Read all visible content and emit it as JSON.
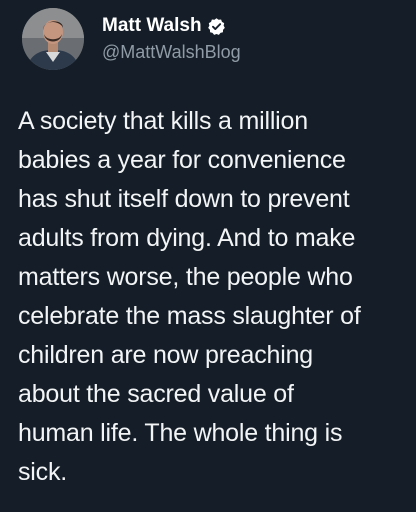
{
  "tweet": {
    "author": {
      "display_name": "Matt Walsh",
      "handle": "@MattWalshBlog",
      "verified": true,
      "avatar_icon": "profile-photo",
      "verified_icon": "verified-badge-icon",
      "verified_color": "#ffffff"
    },
    "text_lines": [
      "A society that kills a million",
      "babies a year for convenience",
      "has shut itself down to prevent",
      "adults from dying. And to make",
      "matters worse, the people who",
      "celebrate the mass slaughter of",
      "children are now preaching",
      "about the sacred value of",
      "human life. The whole thing is",
      "sick."
    ],
    "colors": {
      "background": "#151e28",
      "text": "#f2f4f5",
      "handle": "#8f9ba6"
    }
  }
}
